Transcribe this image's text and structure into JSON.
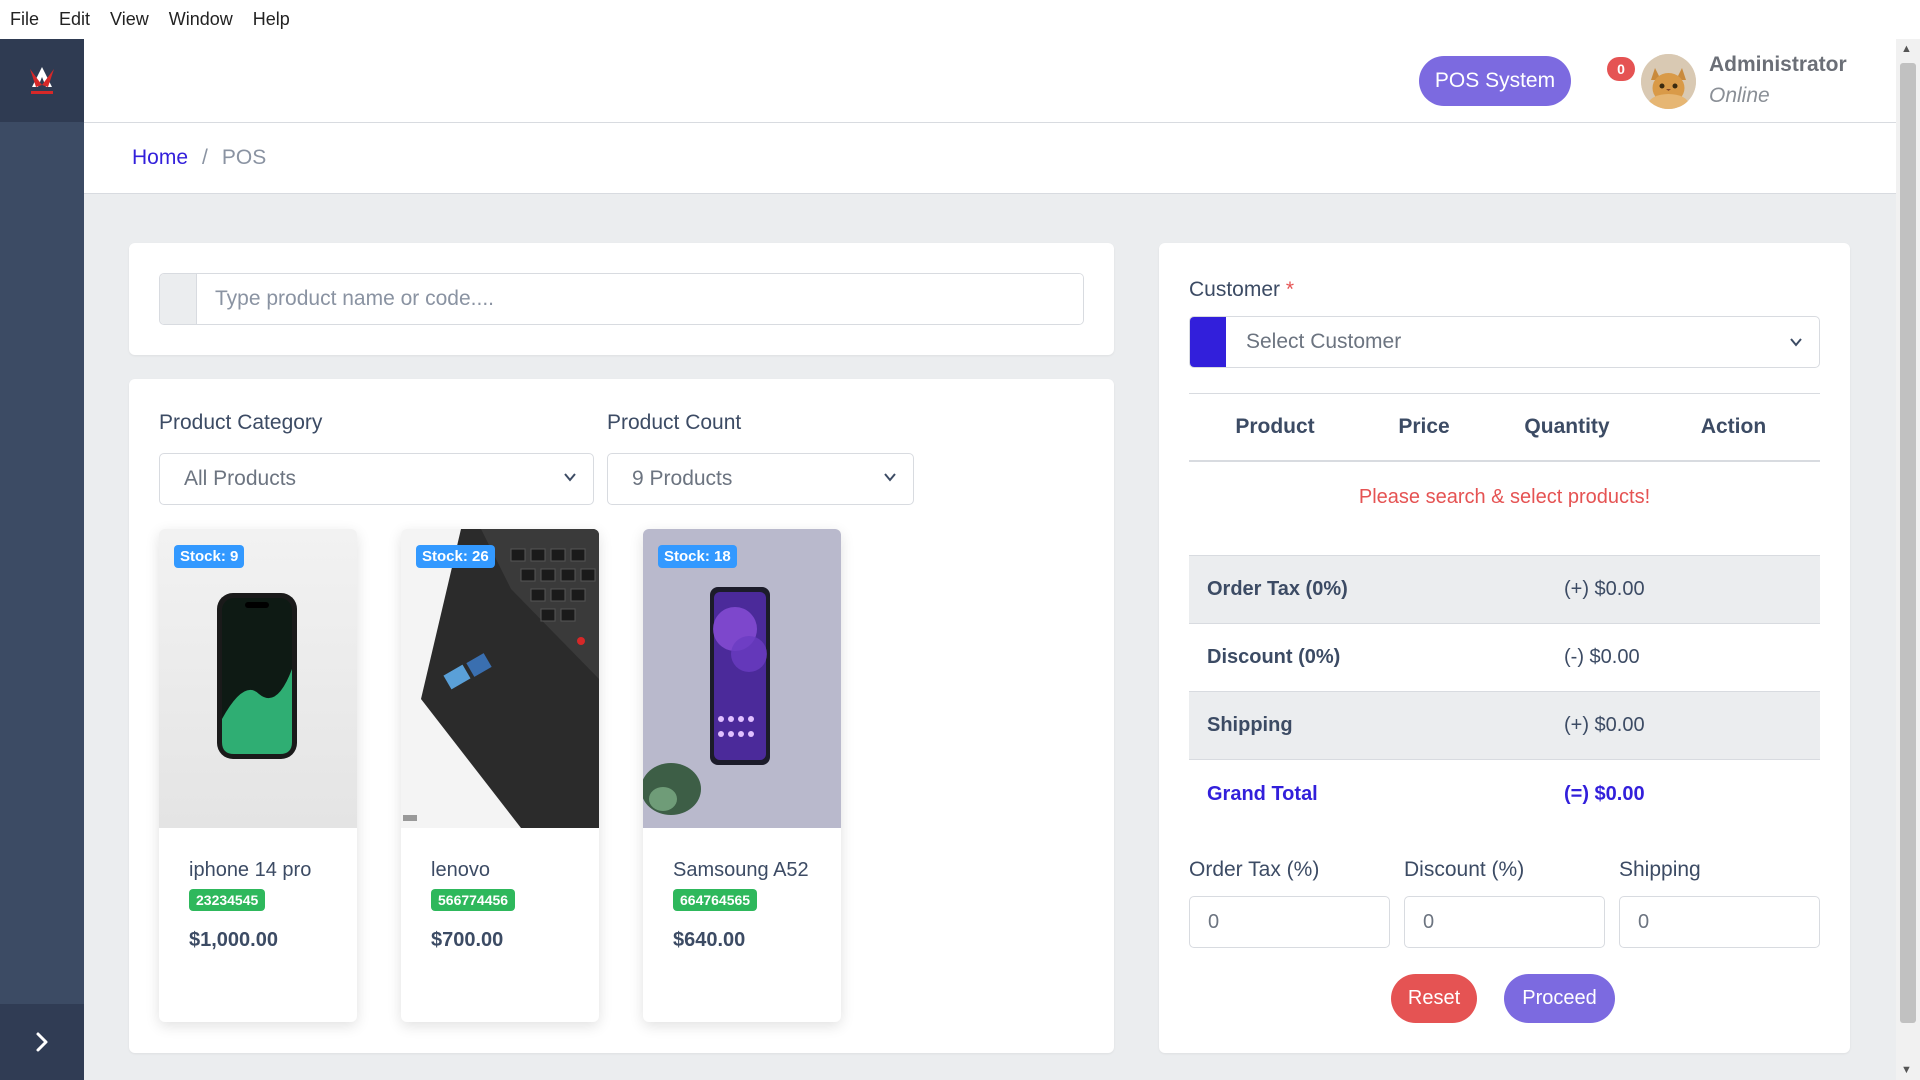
{
  "menubar": {
    "items": [
      "File",
      "Edit",
      "View",
      "Window",
      "Help"
    ]
  },
  "header": {
    "pos_button": "POS System",
    "notification_count": "0",
    "user_name": "Administrator",
    "user_status": "Online"
  },
  "breadcrumb": {
    "home": "Home",
    "separator": "/",
    "current": "POS"
  },
  "search": {
    "placeholder": "Type product name or code...."
  },
  "filters": {
    "category_label": "Product Category",
    "category_value": "All Products",
    "count_label": "Product Count",
    "count_value": "9 Products"
  },
  "products": [
    {
      "name": "iphone 14 pro",
      "code": "23234545",
      "price": "$1,000.00",
      "stock": "Stock: 9"
    },
    {
      "name": "lenovo",
      "code": "566774456",
      "price": "$700.00",
      "stock": "Stock: 26"
    },
    {
      "name": "Samsoung A52",
      "code": "664764565",
      "price": "$640.00",
      "stock": "Stock: 18"
    }
  ],
  "cart": {
    "customer_label": "Customer",
    "required_mark": "*",
    "customer_placeholder": "Select Customer",
    "columns": [
      "Product",
      "Price",
      "Quantity",
      "Action"
    ],
    "empty_message": "Please search & select products!",
    "totals": [
      {
        "label": "Order Tax (0%)",
        "value": "(+) $0.00"
      },
      {
        "label": "Discount (0%)",
        "value": "(-) $0.00"
      },
      {
        "label": "Shipping",
        "value": "(+) $0.00"
      },
      {
        "label": "Grand Total",
        "value": "(=) $0.00"
      }
    ],
    "inputs": [
      {
        "label": "Order Tax (%)",
        "value": "0"
      },
      {
        "label": "Discount (%)",
        "value": "0"
      },
      {
        "label": "Shipping",
        "value": "0"
      }
    ],
    "reset_label": "Reset",
    "proceed_label": "Proceed"
  },
  "colors": {
    "primary": "#321fdb",
    "accent": "#7c6ae0",
    "danger": "#e55353",
    "success": "#2eb85c",
    "info": "#3399ff",
    "sidebar": "#3c4b64"
  },
  "icons": {
    "sidebar_toggle": "chevron-right-icon",
    "select_arrow": "chevron-down-icon",
    "brand": "store-logo-icon"
  }
}
